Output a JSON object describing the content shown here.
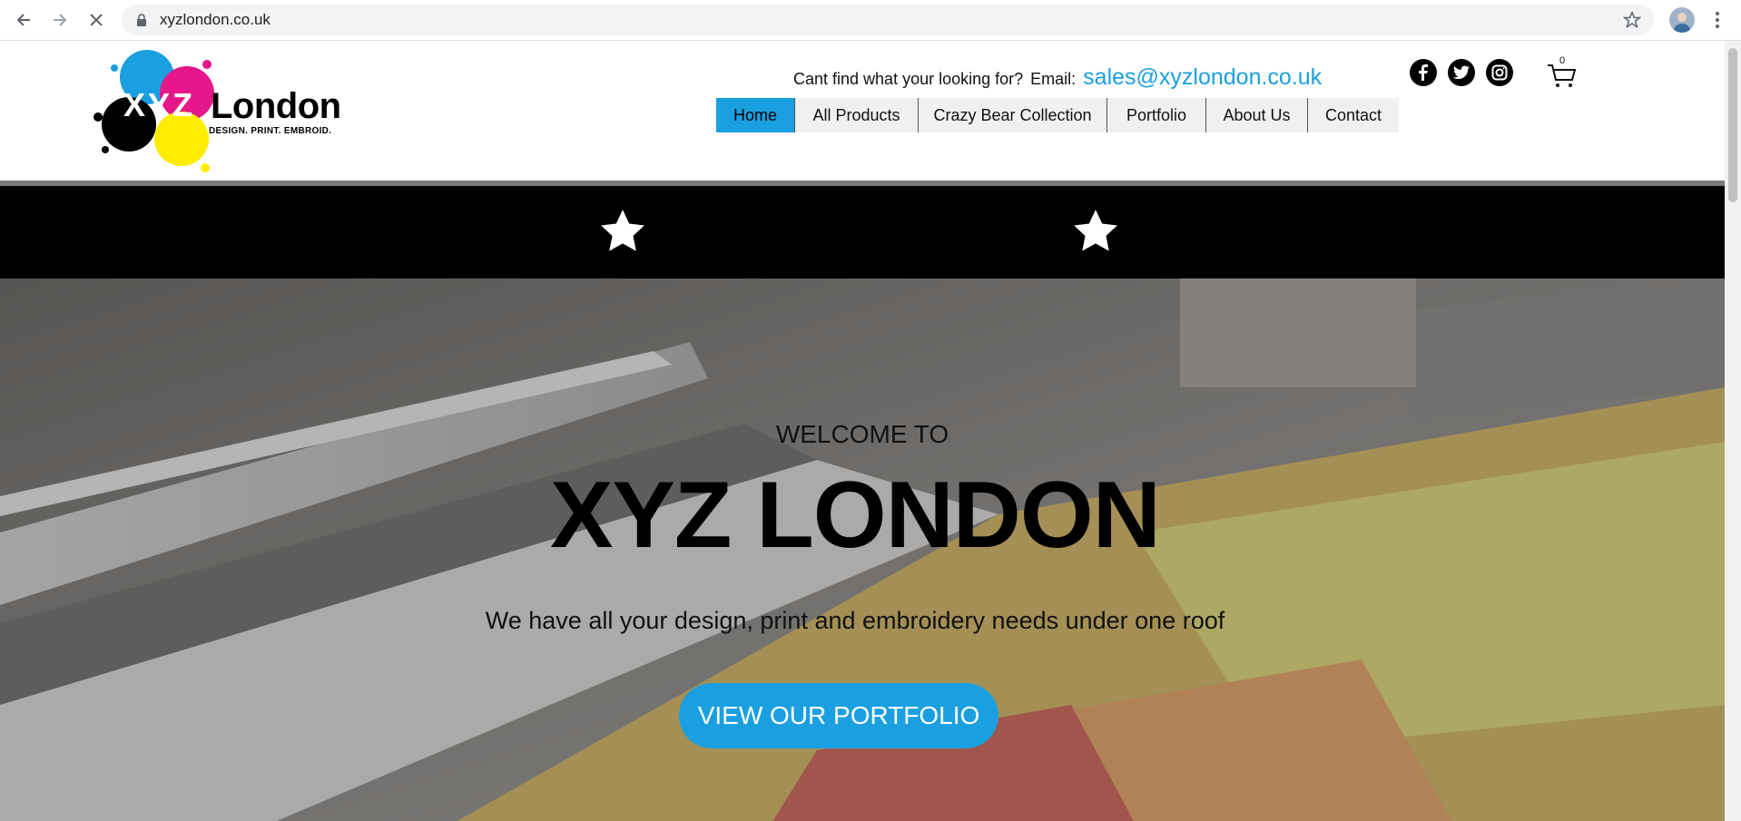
{
  "browser": {
    "url": "xyzlondon.co.uk"
  },
  "logo": {
    "xyz": "XYZ",
    "name": "London",
    "tagline": "DESIGN. PRINT. EMBROID."
  },
  "contact": {
    "question": "Cant find what your looking for?",
    "email_label": "Email:",
    "email": "sales@xyzlondon.co.uk"
  },
  "social": [
    "facebook-icon",
    "twitter-icon",
    "instagram-icon"
  ],
  "cart": {
    "count": "0"
  },
  "menu": [
    {
      "label": "Home",
      "active": true
    },
    {
      "label": "All Products",
      "active": false
    },
    {
      "label": "Crazy Bear Collection",
      "active": false
    },
    {
      "label": "Portfolio",
      "active": false
    },
    {
      "label": "About Us",
      "active": false
    },
    {
      "label": "Contact",
      "active": false
    }
  ],
  "hero": {
    "welcome": "WELCOME TO",
    "title": "XYZ LONDON",
    "subtitle": "We have all your design, print and embroidery needs under one roof",
    "cta": "VIEW OUR PORTFOLIO"
  },
  "colors": {
    "accent": "#1aa0e0",
    "menu_bg": "#f0f0f0",
    "band": "#000000"
  }
}
